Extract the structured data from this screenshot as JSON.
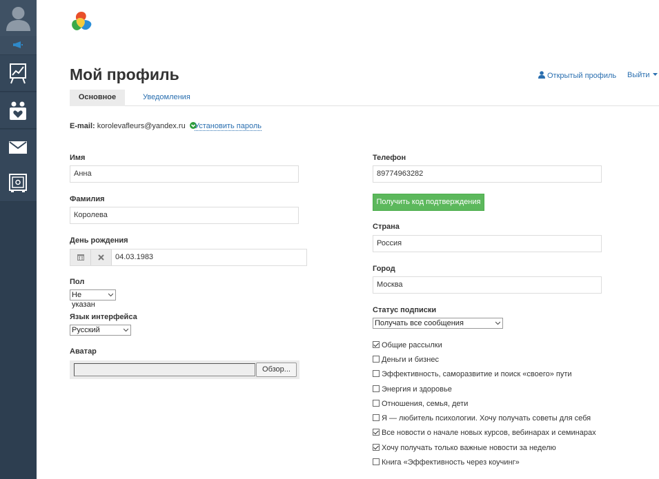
{
  "header": {
    "title": "Мой профиль",
    "public_profile": "Открытый профиль",
    "logout": "Выйти"
  },
  "tabs": [
    {
      "label": "Основное",
      "active": true
    },
    {
      "label": "Уведомления",
      "active": false
    }
  ],
  "email": {
    "label": "E-mail:",
    "value": "korolevafleurs@yandex.ru",
    "verified": true,
    "set_password": "Установить пароль"
  },
  "left": {
    "first_name": {
      "label": "Имя",
      "value": "Анна"
    },
    "last_name": {
      "label": "Фамилия",
      "value": "Королева"
    },
    "birthday": {
      "label": "День рождения",
      "value": "04.03.1983"
    },
    "gender": {
      "label": "Пол",
      "value": "Не указан"
    },
    "language": {
      "label": "Язык интерфейса",
      "value": "Русский"
    },
    "avatar": {
      "label": "Аватар",
      "browse": "Обзор..."
    }
  },
  "right": {
    "phone": {
      "label": "Телефон",
      "value": "89774963282"
    },
    "confirm_button": "Получить код подтверждения",
    "country": {
      "label": "Страна",
      "value": "Россия"
    },
    "city": {
      "label": "Город",
      "value": "Москва"
    },
    "subscription": {
      "label": "Статус подписки",
      "value": "Получать все сообщения"
    },
    "options": [
      {
        "label": "Общие рассылки",
        "checked": true
      },
      {
        "label": "Деньги и бизнес",
        "checked": false
      },
      {
        "label": "Эффективность, саморазвитие и поиск «своего» пути",
        "checked": false
      },
      {
        "label": "Энергия и здоровье",
        "checked": false
      },
      {
        "label": "Отношения, семья, дети",
        "checked": false
      },
      {
        "label": "Я — любитель психологии. Хочу получать советы для себя",
        "checked": false
      },
      {
        "label": "Все новости о начале новых курсов, вебинарах и семинарах",
        "checked": true
      },
      {
        "label": "Хочу получать только важные новости за неделю",
        "checked": true
      },
      {
        "label": "Книга «Эффективность через коучинг»",
        "checked": false
      }
    ]
  },
  "colors": {
    "sidebar": "#2d3e50",
    "link": "#2a6fb0",
    "success": "#5cb85c"
  },
  "sidebar": {
    "icons": [
      "user-avatar-icon",
      "megaphone-icon",
      "chart-board-icon",
      "family-heart-icon",
      "envelope-icon",
      "safe-icon"
    ]
  }
}
